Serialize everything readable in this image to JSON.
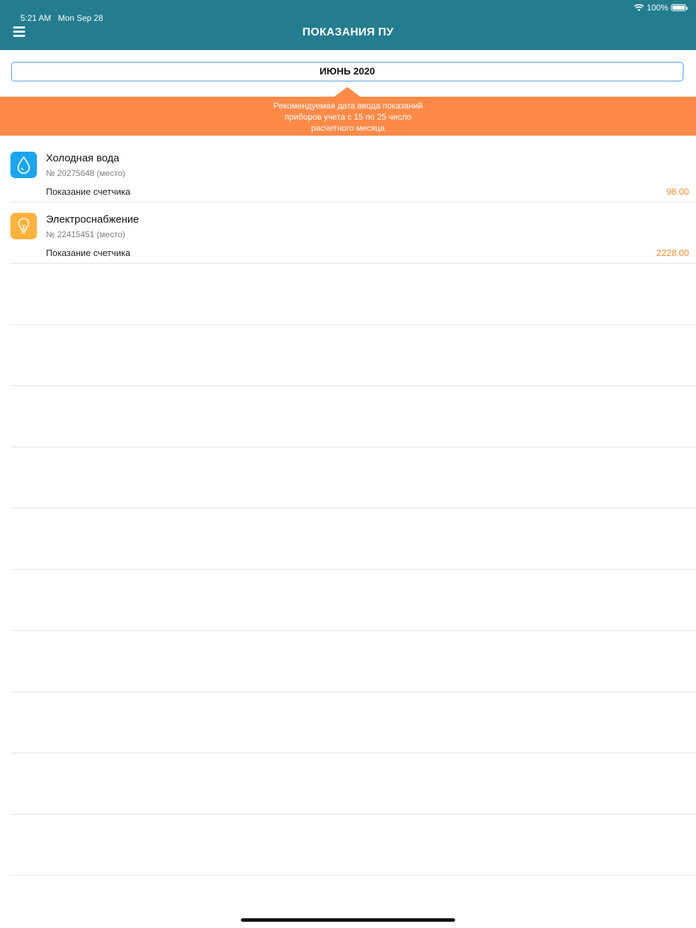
{
  "status_bar": {
    "time": "5:21 AM",
    "date": "Mon Sep 28",
    "battery": "100%"
  },
  "header": {
    "title": "ПОКАЗАНИЯ ПУ"
  },
  "month_selector": {
    "label": "ИЮНЬ 2020"
  },
  "banner": {
    "lines": [
      "Рекомендуемая дата ввода показаний",
      "приборов учета с 15 по 25 число",
      "расчетного месяца"
    ]
  },
  "meters": [
    {
      "name": "Холодная вода",
      "number": "№ 20275648 (место)",
      "label": "Показание счетчика",
      "value": "98.00",
      "icon": "water-drop-icon",
      "icon_color": "#1aa6ef"
    },
    {
      "name": "Электроснабжение",
      "number": "№ 22415451 (место)",
      "label": "Показание счетчика",
      "value": "2228.00",
      "icon": "light-bulb-icon",
      "icon_color": "#ffb23b"
    }
  ],
  "colors": {
    "header": "#237d8f",
    "banner": "#ff8a47",
    "value": "#ff8a2a",
    "selector_border": "#4a9de0"
  }
}
